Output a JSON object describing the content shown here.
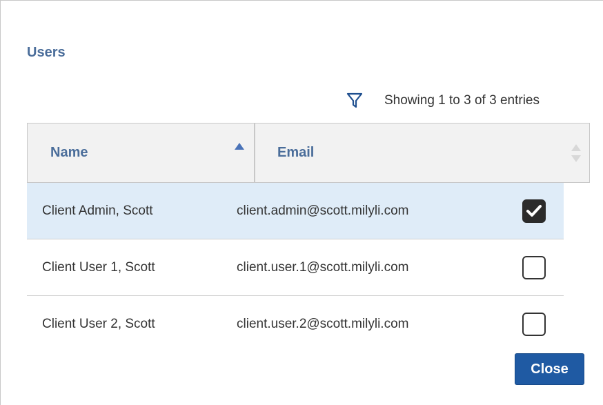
{
  "dialog": {
    "title": "Users",
    "showing_text": "Showing 1 to 3 of 3 entries",
    "close_label": "Close"
  },
  "table": {
    "columns": [
      {
        "label": "Name",
        "sort": "ascending"
      },
      {
        "label": "Email",
        "sort": "none"
      }
    ],
    "rows": [
      {
        "name": "Client Admin, Scott",
        "email": "client.admin@scott.milyli.com",
        "checked": true
      },
      {
        "name": "Client User 1, Scott",
        "email": "client.user.1@scott.milyli.com",
        "checked": false
      },
      {
        "name": "Client User 2, Scott",
        "email": "client.user.2@scott.milyli.com",
        "checked": false
      }
    ]
  },
  "icons": {
    "filter": "filter-icon",
    "sort_asc": "sort-asc-icon",
    "sort_both": "sort-both-icon",
    "checkmark": "checkmark-icon"
  },
  "colors": {
    "accent": "#4a6d9a",
    "selected_row": "#dfecf8",
    "button": "#1f5aa3"
  }
}
